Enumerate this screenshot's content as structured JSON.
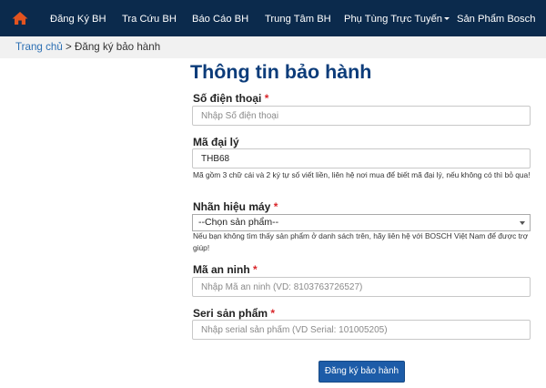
{
  "colors": {
    "navbar_bg": "#0b2a4c",
    "home_icon": "#e2531f",
    "title": "#0c3c7a",
    "required": "#d9262b",
    "link": "#2c6fb3",
    "button_bg": "#1d5ca8"
  },
  "nav": {
    "home_icon": "home-icon",
    "items": [
      {
        "label": "Đăng Ký BH"
      },
      {
        "label": "Tra Cứu BH"
      },
      {
        "label": "Báo Cáo BH"
      },
      {
        "label": "Trung Tâm BH"
      },
      {
        "label": "Phụ Tùng Trực Tuyến"
      },
      {
        "label": "Sản Phẩm Bosch"
      }
    ]
  },
  "breadcrumb": {
    "home": "Trang chủ",
    "separator": ">",
    "current": "Đăng ký bảo hành"
  },
  "form": {
    "title": "Thông tin bảo hành",
    "required_mark": "*",
    "phone": {
      "label": "Số điện thoại",
      "placeholder": "Nhập Số điện thoại",
      "value": ""
    },
    "dealer_code": {
      "label": "Mã đại lý",
      "value": "THB68",
      "help": "Mã gồm 3 chữ cái và 2 ký tự số viết liền, liên hệ nơi mua để biết mã đại lý, nếu không có thì bỏ qua!"
    },
    "brand": {
      "label": "Nhãn hiệu máy",
      "selected": "--Chọn sản phẩm--",
      "help": "Nếu bạn không tìm thấy sản phẩm ở danh sách trên, hãy liên hệ với BOSCH Việt Nam để được trợ giúp!"
    },
    "security_code": {
      "label": "Mã an ninh",
      "placeholder": "Nhập Mã an ninh (VD: 8103763726527)",
      "value": ""
    },
    "serial": {
      "label": "Seri sản phẩm",
      "placeholder": "Nhập serial sản phẩm (VD Serial: 101005205)",
      "value": ""
    },
    "submit_label": "Đăng ký bảo hành"
  }
}
